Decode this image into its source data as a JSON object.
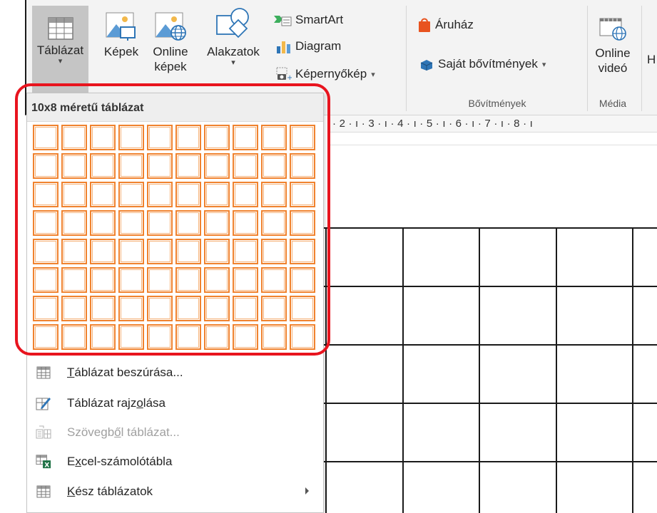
{
  "ribbon": {
    "table_button": {
      "label": "Táblázat"
    },
    "pictures_button": {
      "label": "Képek"
    },
    "online_pictures_button": {
      "line1": "Online",
      "line2": "képek"
    },
    "shapes_button": {
      "label": "Alakzatok"
    },
    "smartart": {
      "label": "SmartArt"
    },
    "chart": {
      "label": "Diagram"
    },
    "screenshot": {
      "label": "Képernyőkép"
    },
    "store": {
      "label": "Áruház"
    },
    "my_addins": {
      "label": "Saját bővítmények"
    },
    "addins_group_label": "Bővítmények",
    "online_video": {
      "line1": "Online",
      "line2": "videó"
    },
    "media_group_label": "Média",
    "cut_letter": "H"
  },
  "ruler": {
    "text": "· 2 · ı · 3 · ı · 4 · ı · 5 · ı · 6 · ı · 7 · ı · 8 · ı"
  },
  "dropdown": {
    "header": "10x8 méretű táblázat",
    "grid": {
      "cols": 10,
      "rows": 8
    },
    "menu": [
      {
        "pre": "",
        "ul": "T",
        "post": "áblázat beszúrása...",
        "icon": "table-icon",
        "disabled": false,
        "submenu": false
      },
      {
        "pre": "Táblázat rajz",
        "ul": "o",
        "post": "lása",
        "icon": "pencil-table-icon",
        "disabled": false,
        "submenu": false
      },
      {
        "pre": "Szövegb",
        "ul": "ő",
        "post": "l táblázat...",
        "icon": "text-to-table-icon",
        "disabled": true,
        "submenu": false
      },
      {
        "pre": "E",
        "ul": "x",
        "post": "cel-számolótábla",
        "icon": "excel-icon",
        "disabled": false,
        "submenu": false
      },
      {
        "pre": "",
        "ul": "K",
        "post": "ész táblázatok",
        "icon": "quick-tables-icon",
        "disabled": false,
        "submenu": true
      }
    ]
  },
  "colors": {
    "grid_border": "#f0822e",
    "highlight": "#e8141e",
    "ribbon_bg": "#f3f3f3"
  }
}
